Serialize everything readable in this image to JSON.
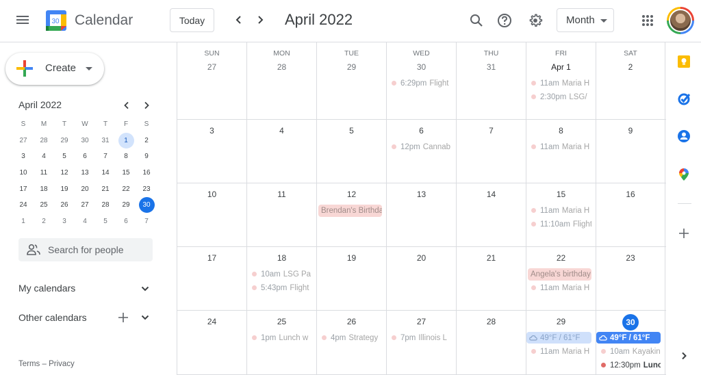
{
  "header": {
    "app_title": "Calendar",
    "logo_day": "30",
    "today_label": "Today",
    "period_title": "April 2022",
    "view_selected": "Month",
    "icons": [
      "menu-icon",
      "prev-icon",
      "next-icon",
      "search-icon",
      "help-icon",
      "settings-icon",
      "apps-grid-icon",
      "avatar"
    ]
  },
  "sidebar": {
    "create_label": "Create",
    "mini_calendar": {
      "title": "April 2022",
      "weekdays": [
        "S",
        "M",
        "T",
        "W",
        "T",
        "F",
        "S"
      ],
      "weeks": [
        [
          "27",
          "28",
          "29",
          "30",
          "31",
          "1",
          "2"
        ],
        [
          "3",
          "4",
          "5",
          "6",
          "7",
          "8",
          "9"
        ],
        [
          "10",
          "11",
          "12",
          "13",
          "14",
          "15",
          "16"
        ],
        [
          "17",
          "18",
          "19",
          "20",
          "21",
          "22",
          "23"
        ],
        [
          "24",
          "25",
          "26",
          "27",
          "28",
          "29",
          "30"
        ],
        [
          "1",
          "2",
          "3",
          "4",
          "5",
          "6",
          "7"
        ]
      ],
      "selected_day": "1",
      "today": "30"
    },
    "people_search_placeholder": "Search for people",
    "my_calendars_label": "My calendars",
    "other_calendars_label": "Other calendars",
    "footer": "Terms – Privacy"
  },
  "month": {
    "weekdays": [
      "SUN",
      "MON",
      "TUE",
      "WED",
      "THU",
      "FRI",
      "SAT"
    ],
    "weeks": [
      [
        {
          "day": "27",
          "other": true,
          "events": []
        },
        {
          "day": "28",
          "other": true,
          "events": []
        },
        {
          "day": "29",
          "other": true,
          "events": []
        },
        {
          "day": "30",
          "other": true,
          "events": [
            {
              "time": "6:29pm",
              "title": "Flight"
            }
          ]
        },
        {
          "day": "31",
          "other": true,
          "events": []
        },
        {
          "day": "Apr 1",
          "bold": true,
          "events": [
            {
              "time": "11am",
              "title": "Maria H"
            },
            {
              "time": "2:30pm",
              "title": "LSG/"
            }
          ]
        },
        {
          "day": "2",
          "events": []
        }
      ],
      [
        {
          "day": "3",
          "events": []
        },
        {
          "day": "4",
          "events": []
        },
        {
          "day": "5",
          "events": []
        },
        {
          "day": "6",
          "events": [
            {
              "time": "12pm",
              "title": "Cannab"
            }
          ]
        },
        {
          "day": "7",
          "events": []
        },
        {
          "day": "8",
          "events": [
            {
              "time": "11am",
              "title": "Maria H"
            }
          ]
        },
        {
          "day": "9",
          "events": []
        }
      ],
      [
        {
          "day": "10",
          "events": []
        },
        {
          "day": "11",
          "events": []
        },
        {
          "day": "12",
          "allday": "Brendan's Birthday",
          "events": []
        },
        {
          "day": "13",
          "events": []
        },
        {
          "day": "14",
          "events": []
        },
        {
          "day": "15",
          "events": [
            {
              "time": "11am",
              "title": "Maria H"
            },
            {
              "time": "11:10am",
              "title": "Flight"
            }
          ]
        },
        {
          "day": "16",
          "events": []
        }
      ],
      [
        {
          "day": "17",
          "events": []
        },
        {
          "day": "18",
          "events": [
            {
              "time": "10am",
              "title": "LSG Pa"
            },
            {
              "time": "5:43pm",
              "title": "Flight"
            }
          ]
        },
        {
          "day": "19",
          "events": []
        },
        {
          "day": "20",
          "events": []
        },
        {
          "day": "21",
          "events": []
        },
        {
          "day": "22",
          "allday": "Angela's birthday",
          "events": [
            {
              "time": "11am",
              "title": "Maria H"
            }
          ]
        },
        {
          "day": "23",
          "events": []
        }
      ],
      [
        {
          "day": "24",
          "events": []
        },
        {
          "day": "25",
          "events": [
            {
              "time": "1pm",
              "title": "Lunch w"
            }
          ]
        },
        {
          "day": "26",
          "events": [
            {
              "time": "4pm",
              "title": "Strategy"
            }
          ]
        },
        {
          "day": "27",
          "events": [
            {
              "time": "7pm",
              "title": "Illinois L"
            }
          ]
        },
        {
          "day": "28",
          "events": []
        },
        {
          "day": "29",
          "weather": {
            "text": "49°F / 61°F",
            "style": "light"
          },
          "events": [
            {
              "time": "11am",
              "title": "Maria H"
            }
          ]
        },
        {
          "day": "30",
          "today": true,
          "weather": {
            "text": "49°F / 61°F",
            "style": "dark"
          },
          "events": [
            {
              "time": "10am",
              "title": "Kayaking"
            },
            {
              "time": "12:30pm",
              "title": "Lunch",
              "strong": true
            }
          ]
        }
      ]
    ]
  },
  "side_panel": {
    "icons": [
      "keep-icon",
      "tasks-icon",
      "contacts-icon",
      "maps-icon",
      "add-addon-icon",
      "expand-panel-icon"
    ]
  },
  "colors": {
    "accent": "#1a73e8",
    "event_dot": "#f6cfcf",
    "event_dot_active": "#e06b67",
    "allday_bg": "#f8d7d5",
    "weather_light": "#cfe0fb",
    "weather_dark": "#4285f4"
  }
}
